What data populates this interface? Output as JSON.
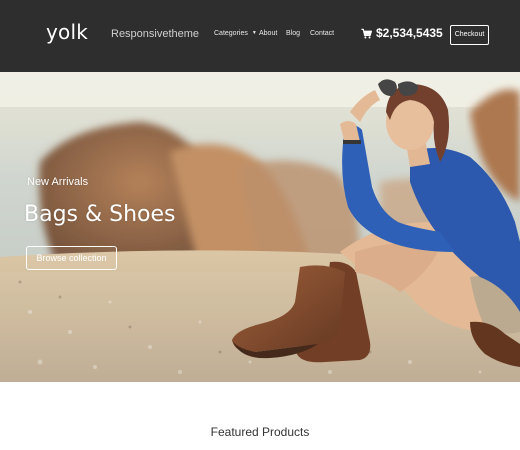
{
  "header": {
    "logo": "yolk",
    "tagline": "Responsivetheme",
    "nav": [
      {
        "label": "Categories",
        "has_dropdown": true
      },
      {
        "label": "About"
      },
      {
        "label": "Blog"
      },
      {
        "label": "Contact"
      }
    ],
    "cart": {
      "icon": "cart-icon",
      "total": "$2,534,5435"
    },
    "checkout_label": "Checkout"
  },
  "hero": {
    "subtitle": "New Arrivals",
    "title": "Bags & Shoes",
    "button_label": "Browse collection"
  },
  "featured": {
    "heading": "Featured Products"
  },
  "colors": {
    "header_bg": "#2e2e2e",
    "text_light": "#ffffff",
    "sweater": "#1f4fa8",
    "boots": "#7a3e1f"
  }
}
